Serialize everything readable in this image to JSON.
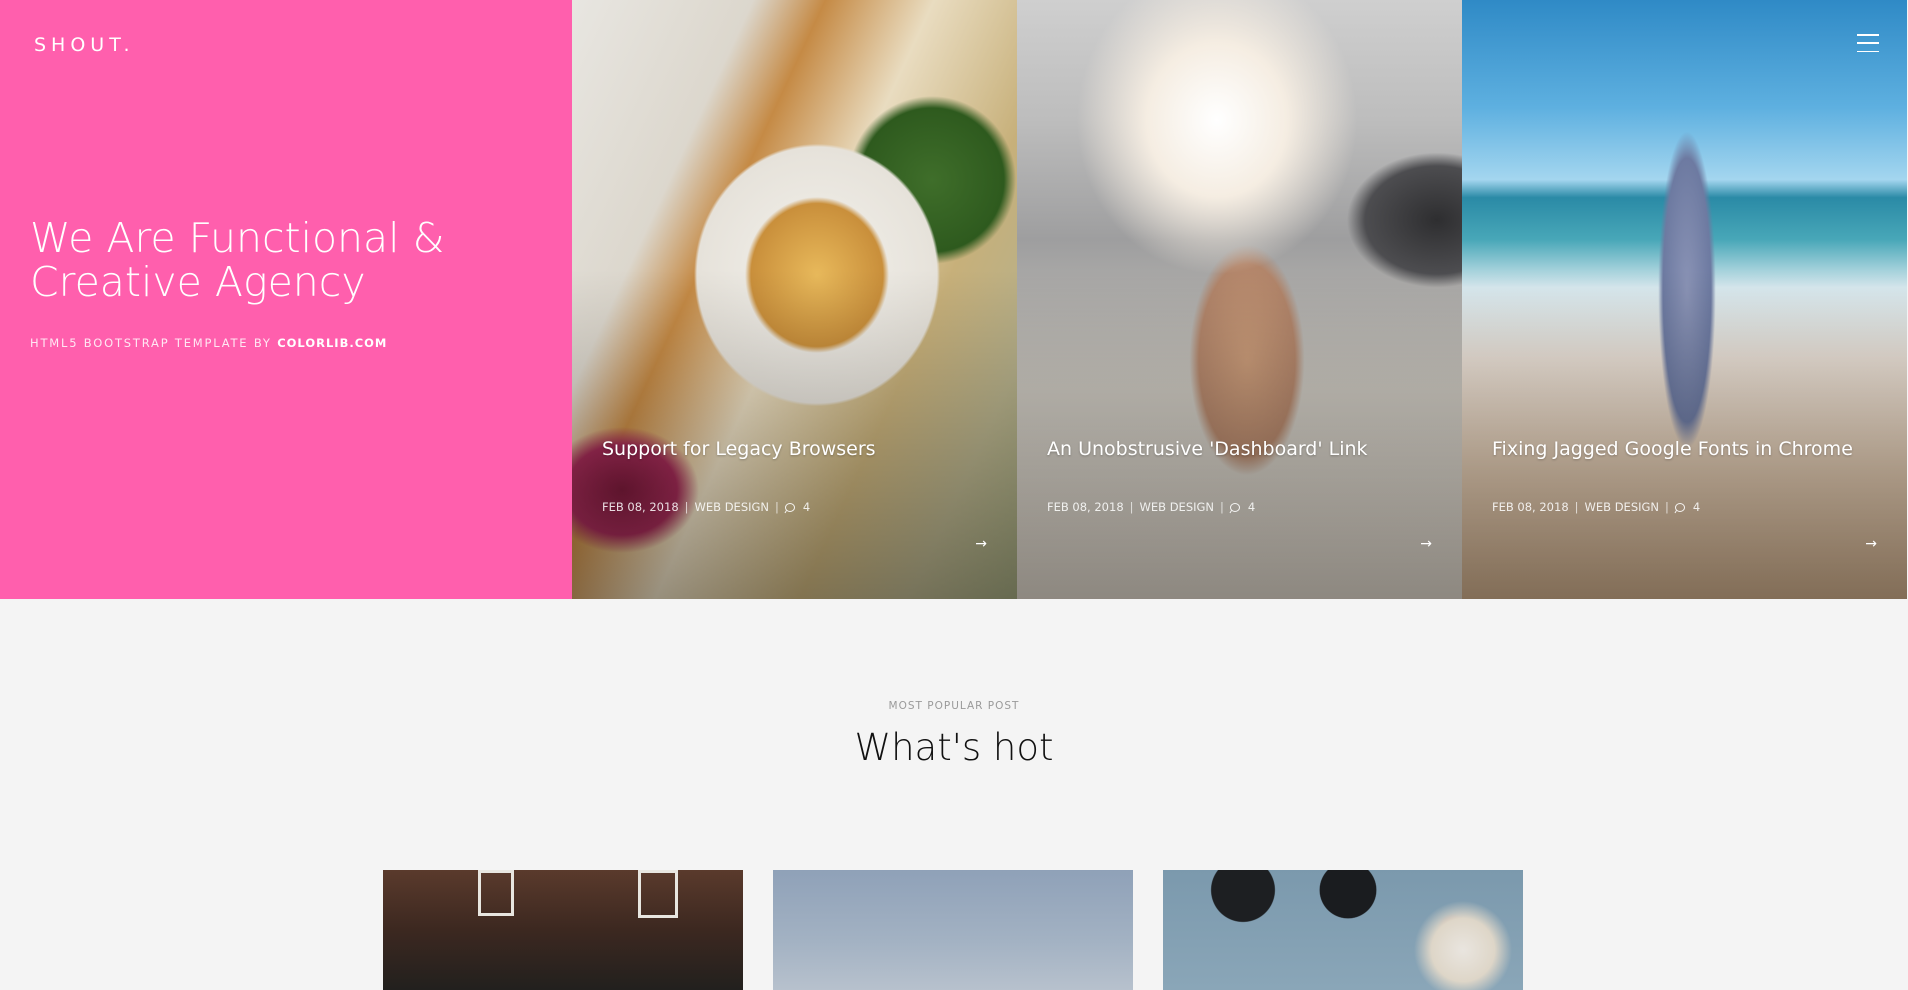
{
  "brand": {
    "logo": "SHOUT."
  },
  "hero": {
    "title": "We Are Functional & Creative Agency",
    "subtitle_prefix": "HTML5 BOOTSTRAP TEMPLATE BY",
    "subtitle_link": "COLORLIB.COM"
  },
  "posts": [
    {
      "title": "Support for Legacy Browsers",
      "date": "FEB 08, 2018",
      "category": "WEB DESIGN",
      "comments": "4"
    },
    {
      "title": "An Unobstrusive 'Dashboard' Link",
      "date": "FEB 08, 2018",
      "category": "WEB DESIGN",
      "comments": "4"
    },
    {
      "title": "Fixing Jagged Google Fonts in Chrome",
      "date": "FEB 08, 2018",
      "category": "WEB DESIGN",
      "comments": "4"
    }
  ],
  "popular": {
    "eyebrow": "MOST POPULAR POST",
    "title": "What's hot"
  },
  "colors": {
    "accent": "#ff5fad",
    "background": "#f4f4f4"
  },
  "icons": {
    "menu": "hamburger-icon",
    "comment": "comment-icon",
    "arrow": "arrow-right-icon"
  }
}
